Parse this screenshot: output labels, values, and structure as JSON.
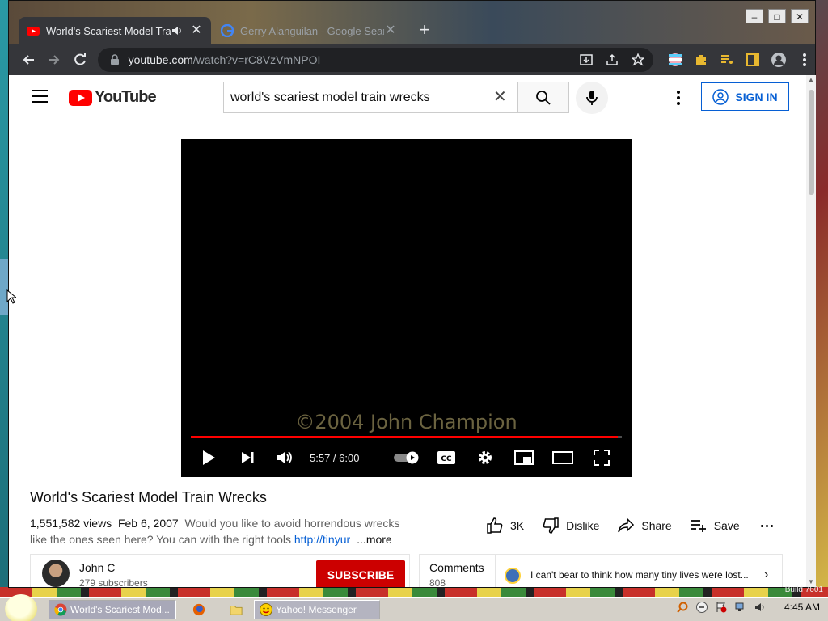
{
  "browser": {
    "tabs": [
      {
        "title": "World's Scariest Model Train",
        "favicon": "youtube-icon",
        "active": true
      },
      {
        "title": "Gerry Alanguilan - Google Search",
        "favicon": "google-icon",
        "active": false
      }
    ],
    "url_host": "youtube.com",
    "url_path": "/watch?v=rC8VzVmNPOI"
  },
  "youtube": {
    "logo_text": "YouTube",
    "search_query": "world's scariest model train wrecks",
    "sign_in_label": "SIGN IN"
  },
  "player": {
    "watermark": "©2004 John Champion",
    "time": "5:57 / 6:00",
    "progress_fraction": 0.99,
    "cc_label": "CC"
  },
  "video": {
    "title": "World's Scariest Model Train Wrecks",
    "views": "1,551,582 views",
    "date": "Feb 6, 2007",
    "description_line1": "Would you like to avoid horrendous wrecks",
    "description_line2": "like the ones seen here? You can with the right tools",
    "description_link": "http://tinyur",
    "more_label": "...more",
    "likes": "3K",
    "dislike_label": "Dislike",
    "share_label": "Share",
    "save_label": "Save"
  },
  "channel": {
    "name": "John C",
    "subscribers": "279 subscribers",
    "subscribe_label": "SUBSCRIBE"
  },
  "comments": {
    "label": "Comments",
    "count": "808",
    "preview": "I can't bear to think how many tiny lives were lost..."
  },
  "taskbar": {
    "chrome_task": "World's Scariest Mod...",
    "yahoo_task": "Yahoo! Messenger",
    "clock": "4:45 AM",
    "build": "Build 7601"
  },
  "colors": {
    "yt_red": "#ff0000",
    "subscribe_red": "#cc0000",
    "link_blue": "#065fd4"
  }
}
